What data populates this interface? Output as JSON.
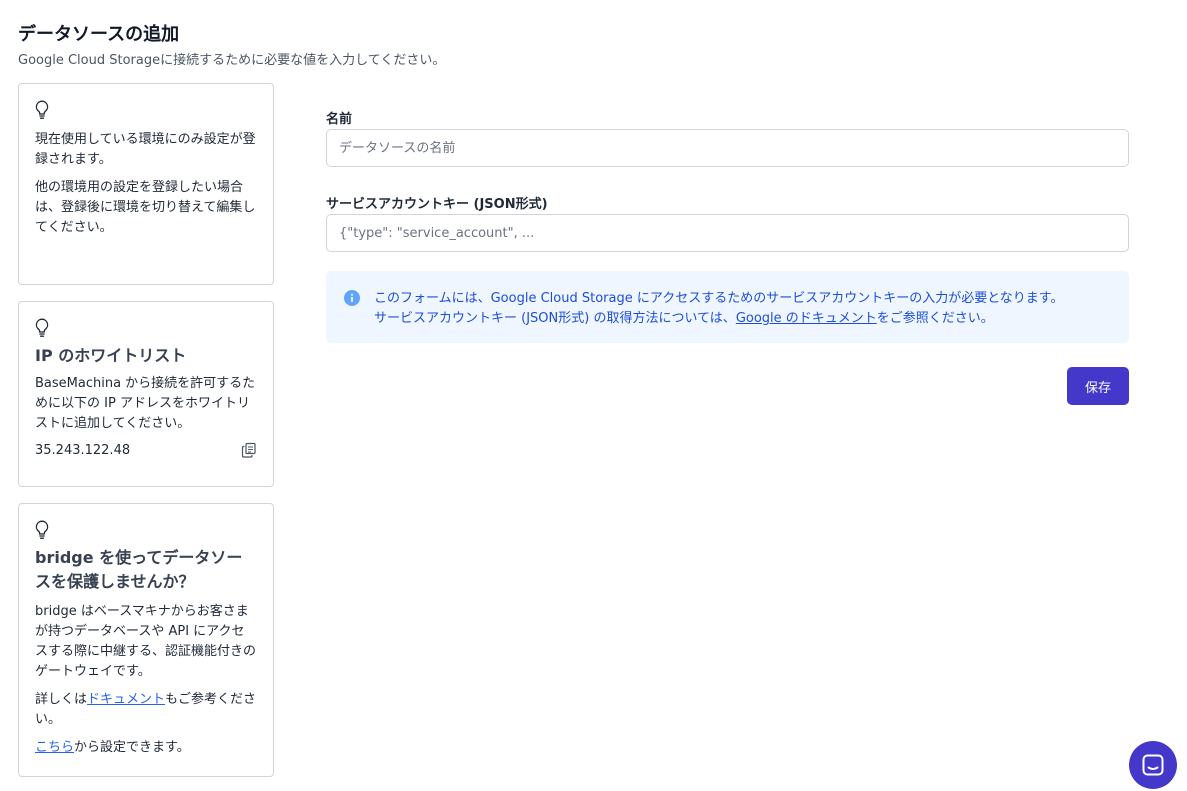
{
  "header": {
    "title": "データソースの追加",
    "subtitle": "Google Cloud Storageに接続するために必要な値を入力してください。"
  },
  "sidebar": {
    "env_card": {
      "icon": "lightbulb-icon",
      "text1": "現在使用している環境にのみ設定が登録されます。",
      "text2": "他の環境用の設定を登録したい場合は、登録後に環境を切り替えて編集してください。"
    },
    "ip_card": {
      "icon": "lightbulb-icon",
      "title": "IP のホワイトリスト",
      "text": "BaseMachina から接続を許可するために以下の IP アドレスをホワイトリストに追加してください。",
      "ip": "35.243.122.48",
      "copy_icon": "copy-icon"
    },
    "bridge_card": {
      "icon": "lightbulb-icon",
      "title": "bridge を使ってデータソースを保護しませんか？",
      "text": "bridge はベースマキナからお客さまが持つデータベースや API にアクセスする際に中継する、認証機能付きのゲートウェイです。",
      "doc_prefix": "詳しくは",
      "doc_link": "ドキュメント",
      "doc_suffix": "もご参考ください。",
      "settings_link": "こちら",
      "settings_suffix": "から設定できます。"
    }
  },
  "form": {
    "name": {
      "label": "名前",
      "value": "",
      "placeholder": "データソースの名前"
    },
    "service_account": {
      "label": "サービスアカウントキー (JSON形式)",
      "value": "",
      "placeholder": "{\"type\": \"service_account\", ..."
    },
    "info": {
      "icon": "info-icon",
      "line1": "このフォームには、Google Cloud Storage にアクセスするためのサービスアカウントキーの入力が必要となります。",
      "line2_prefix": "サービスアカウントキー (JSON形式) の取得方法については、",
      "line2_link": "Google のドキュメント",
      "line2_suffix": "をご参照ください。"
    },
    "save_label": "保存"
  },
  "chat": {
    "icon": "chat-icon"
  },
  "colors": {
    "primary": "#4338ca",
    "info_bg": "#eff6ff",
    "info_text": "#1d4ed8",
    "link": "#2563eb"
  }
}
